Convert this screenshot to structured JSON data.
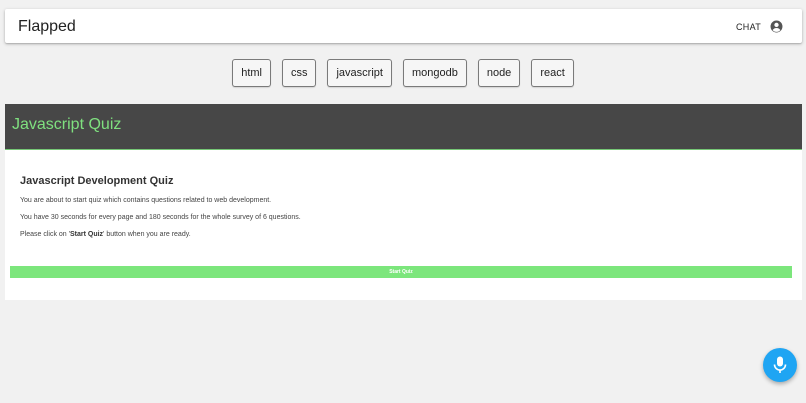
{
  "appbar": {
    "brand": "Flapped",
    "chat_label": "CHAT",
    "account_icon": "account-circle-icon"
  },
  "topics": [
    "html",
    "css",
    "javascript",
    "mongodb",
    "node",
    "react"
  ],
  "quiz": {
    "header_title": "Javascript Quiz",
    "title": "Javascript Development Quiz",
    "line1": "You are about to start quiz which contains questions related to web development.",
    "line2": "You have 30 seconds for every page and 180 seconds for the whole survey of 6 questions.",
    "line3_prefix": "Please click on '",
    "line3_bold": "Start Quiz",
    "line3_suffix": "' button when you are ready.",
    "start_label": "Start Quiz"
  },
  "fab": {
    "icon": "microphone-icon"
  },
  "colors": {
    "header_bg": "#474747",
    "header_text": "#7fe07f",
    "start_button": "#7ce67c",
    "fab": "#1fa5f3"
  }
}
